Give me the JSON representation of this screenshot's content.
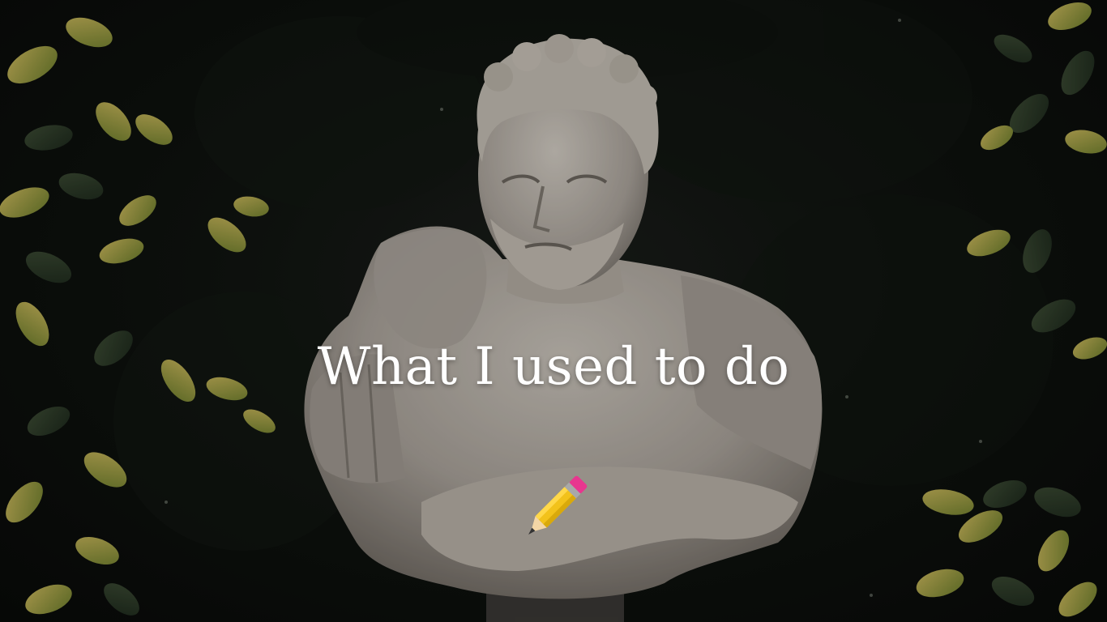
{
  "slide": {
    "title": "What I used to do"
  },
  "icons": {
    "decoration": "pencil-icon"
  },
  "colors": {
    "background": "#0d110d",
    "statue": "#b8b1a8",
    "leaves": "#8e9a3f",
    "title": "#ffffff",
    "pencil_body": "#f2c21b",
    "pencil_eraser": "#e8368f"
  }
}
